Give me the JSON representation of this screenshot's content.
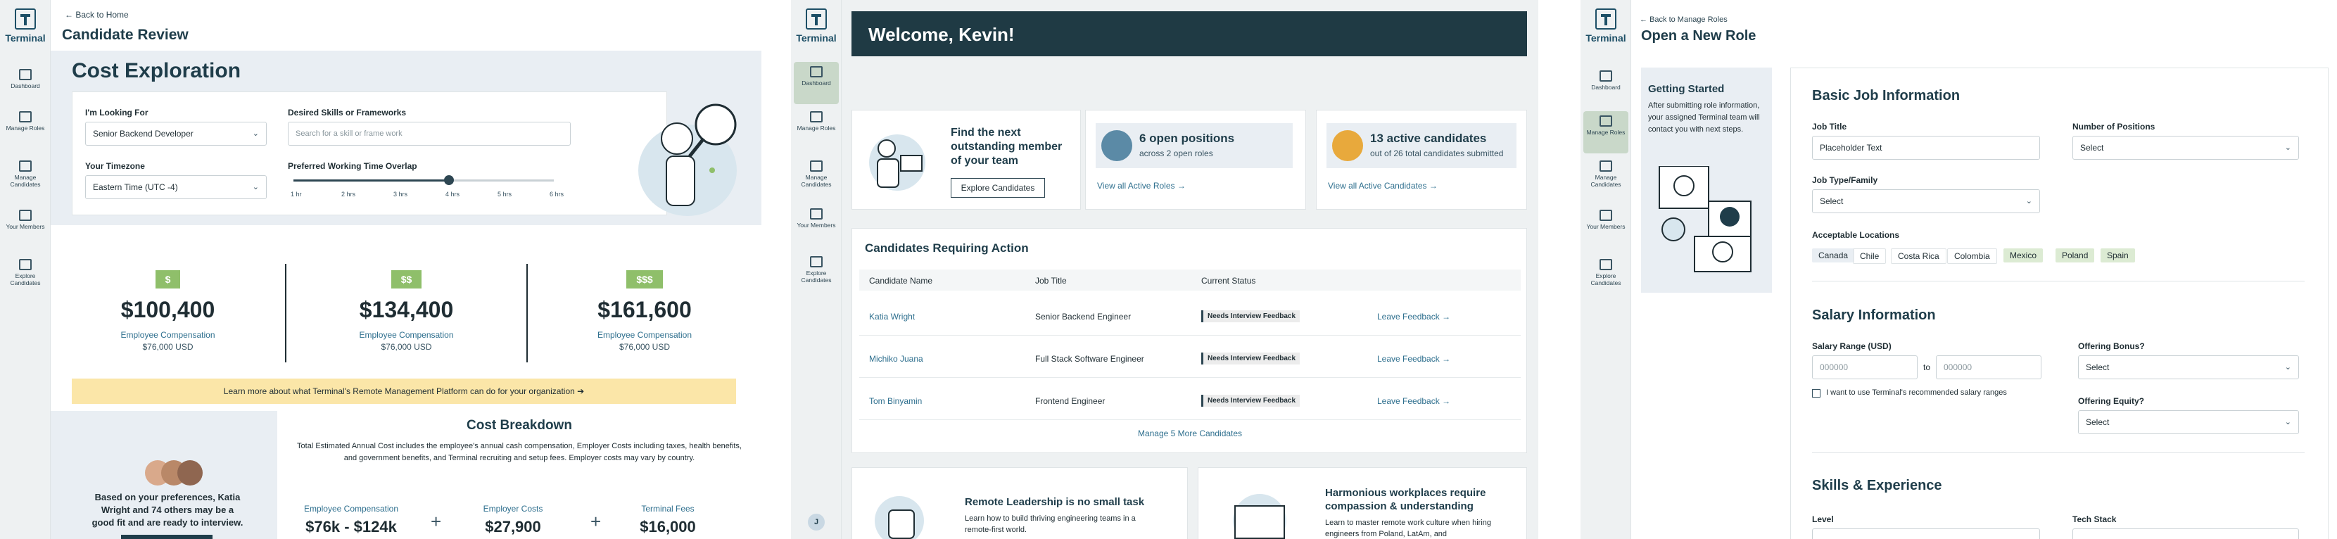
{
  "nav": {
    "logo": "Terminal",
    "items": [
      "Dashboard",
      "Manage Roles",
      "Manage Candidates",
      "Your Members",
      "Explore Candidates"
    ]
  },
  "review": {
    "back": "Back to Home",
    "title": "Candidate Review",
    "heading": "Cost Exploration",
    "looking_label": "I'm Looking For",
    "looking_value": "Senior Backend Developer",
    "timezone_label": "Your Timezone",
    "timezone_value": "Eastern Time (UTC -4)",
    "skills_label": "Desired Skills or Frameworks",
    "skills_placeholder": "Search for a skill or frame work",
    "overlap_label": "Preferred Working Time Overlap",
    "overlap_ticks": [
      "1 hr",
      "2 hrs",
      "3 hrs",
      "4 hrs",
      "5 hrs",
      "6 hrs"
    ],
    "tiers": [
      {
        "badge": "$",
        "amount": "$100,400",
        "label": "Employee Compensation",
        "sub": "$76,000 USD"
      },
      {
        "badge": "$$",
        "amount": "$134,400",
        "label": "Employee Compensation",
        "sub": "$76,000 USD"
      },
      {
        "badge": "$$$",
        "amount": "$161,600",
        "label": "Employee Compensation",
        "sub": "$76,000 USD"
      }
    ],
    "banner": "Learn more about what Terminal's Remote Management Platform can do for your organization",
    "breakdown_title": "Cost Breakdown",
    "breakdown_text": "Total Estimated Annual Cost includes the employee's annual cash compensation, Employer Costs including taxes, health benefits, and government benefits, and Terminal recruiting and setup fees. Employer costs may vary by country.",
    "match_text": "Based on your preferences, Katia Wright and 74 others may be a good fit and are ready to interview.",
    "cost_items": [
      {
        "label": "Employee Compensation",
        "value": "$76k - $124k"
      },
      {
        "label": "Employer Costs",
        "value": "$27,900"
      },
      {
        "label": "Terminal Fees",
        "value": "$16,000"
      }
    ]
  },
  "dashboard": {
    "welcome": "Welcome, Kevin!",
    "card1_title": "Find the next outstanding member of your team",
    "card1_button": "Explore Candidates",
    "card2_title": "6 open positions",
    "card2_sub": "across 2 open roles",
    "card2_link": "View all Active Roles",
    "card3_title": "13 active candidates",
    "card3_sub": "out of 26 total candidates submitted",
    "card3_link": "View all Active Candidates",
    "table_title": "Candidates Requiring Action",
    "columns": [
      "Candidate Name",
      "Job Title",
      "Current Status"
    ],
    "rows": [
      {
        "name": "Katia Wright",
        "job": "Senior Backend Engineer",
        "status": "Needs Interview Feedback",
        "action": "Leave Feedback"
      },
      {
        "name": "Michiko Juana",
        "job": "Full Stack Software Engineer",
        "status": "Needs Interview Feedback",
        "action": "Leave Feedback"
      },
      {
        "name": "Tom Binyamin",
        "job": "Frontend Engineer",
        "status": "Needs Interview Feedback",
        "action": "Leave Feedback"
      }
    ],
    "manage_more": "Manage 5 More Candidates",
    "promo1_title": "Remote Leadership is no small task",
    "promo1_text": "Learn how to build thriving engineering teams in a remote-first world.",
    "promo2_title": "Harmonious workplaces require compassion & understanding",
    "promo2_text": "Learn to master remote work culture when hiring engineers from Poland, LatAm, and",
    "avatar_initial": "J"
  },
  "newrole": {
    "back": "Back to Manage Roles",
    "title": "Open a New Role",
    "gs_title": "Getting Started",
    "gs_text": "After submitting role information, your assigned Terminal team will contact you with next steps.",
    "basic_title": "Basic Job Information",
    "job_title_label": "Job Title",
    "job_title_value": "Placeholder Text",
    "positions_label": "Number of Positions",
    "positions_value": "Select",
    "type_label": "Job Type/Family",
    "type_value": "Select",
    "locations_label": "Acceptable Locations",
    "locations": [
      "Canada",
      "Chile",
      "Costa Rica",
      "Colombia",
      "Mexico",
      "Poland",
      "Spain"
    ],
    "salary_title": "Salary Information",
    "salary_label": "Salary Range (USD)",
    "salary_min": "000000",
    "salary_to": "to",
    "salary_max": "000000",
    "salary_check": "I want to use Terminal's recommended salary ranges",
    "bonus_label": "Offering Bonus?",
    "bonus_value": "Select",
    "equity_label": "Offering Equity?",
    "equity_value": "Select",
    "skills_title": "Skills & Experience",
    "level_label": "Level",
    "tech_label": "Tech Stack"
  },
  "colors": {
    "sidebar": "#eef1f2",
    "accent_green": "#8fbf6a",
    "navy": "#1f3d4a",
    "banner": "#fbe6a8",
    "welcome_bg": "#1f3a44"
  }
}
